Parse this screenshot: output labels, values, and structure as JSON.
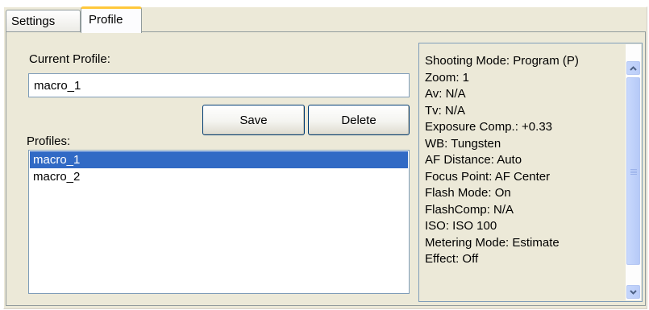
{
  "tabs": [
    {
      "label": "Settings",
      "active": false
    },
    {
      "label": "Profile",
      "active": true
    }
  ],
  "current_profile": {
    "label": "Current Profile:",
    "value": "macro_1"
  },
  "buttons": {
    "save": "Save",
    "delete": "Delete"
  },
  "profiles": {
    "label": "Profiles:",
    "items": [
      "macro_1",
      "macro_2"
    ],
    "selected": "macro_1"
  },
  "info": {
    "lines": [
      "Shooting Mode: Program (P)",
      "Zoom: 1",
      "Av: N/A",
      "Tv: N/A",
      "Exposure Comp.: +0.33",
      "WB: Tungsten",
      "AF Distance: Auto",
      "Focus Point: AF Center",
      "Flash Mode: On",
      "FlashComp: N/A",
      "ISO: ISO 100",
      "Metering Mode: Estimate",
      "Effect: Off"
    ]
  },
  "colors": {
    "selection": "#316ac5",
    "active_tab_accent": "#ffc83c",
    "panel_background": "#ece9d8"
  },
  "icons": {
    "scroll_up": "chevron-up-icon",
    "scroll_down": "chevron-down-icon"
  }
}
